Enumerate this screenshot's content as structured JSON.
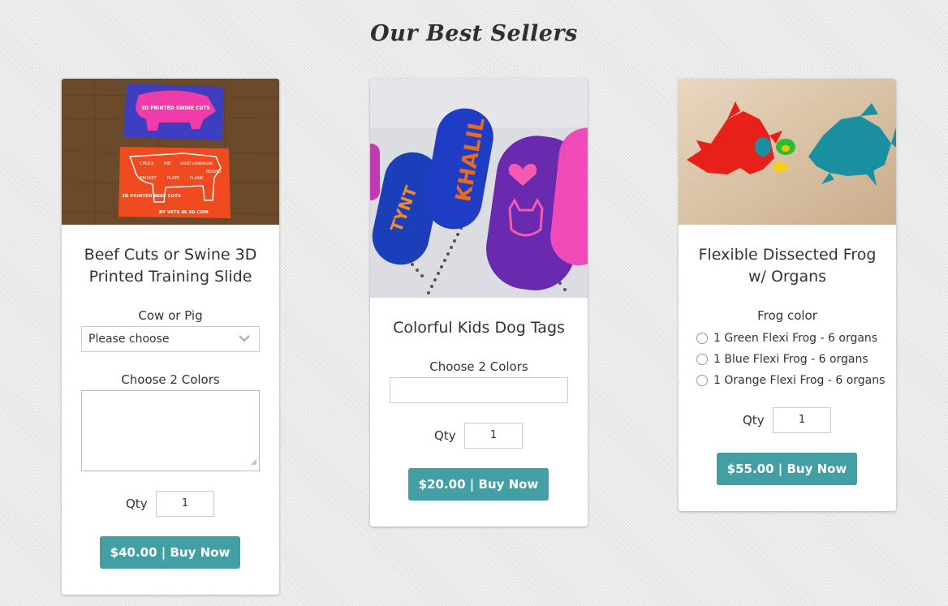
{
  "section_title": "Our Best Sellers",
  "products": [
    {
      "title_line1": "Beef Cuts or Swine 3D",
      "title_line2": "Printed Training Slide",
      "select_label": "Cow or Pig",
      "select_value": "Please choose",
      "colors_label": "Choose 2 Colors",
      "qty_label": "Qty",
      "qty_value": "1",
      "buy_label": "$40.00 | Buy Now",
      "image_text": {
        "pig_title": "3D PRINTED SWINE CUTS",
        "cow_cuts": [
          "CHUCK",
          "RIB",
          "SHORT LOIN",
          "SIRLOIN",
          "BRISKET",
          "PLATE",
          "FLANK",
          "ROUND"
        ],
        "cow_title": "3D PRINTED BEEF CUTS",
        "footer": "BY VETS IN 3D.COM"
      }
    },
    {
      "title": "Colorful Kids Dog Tags",
      "colors_label": "Choose 2 Colors",
      "qty_label": "Qty",
      "qty_value": "1",
      "buy_label": "$20.00 | Buy Now",
      "image_text": {
        "tag_name": "KHALIL",
        "tag_left": "TYNT"
      }
    },
    {
      "title_line1": "Flexible Dissected Frog",
      "title_line2": "w/ Organs",
      "radio_label": "Frog color",
      "options": [
        "1 Green Flexi Frog - 6 organs",
        "1 Blue Flexi Frog - 6 organs",
        "1 Orange Flexi Frog - 6 organs"
      ],
      "qty_label": "Qty",
      "qty_value": "1",
      "buy_label": "$55.00 | Buy Now"
    }
  ],
  "colors": {
    "button": "#42a0a4"
  }
}
